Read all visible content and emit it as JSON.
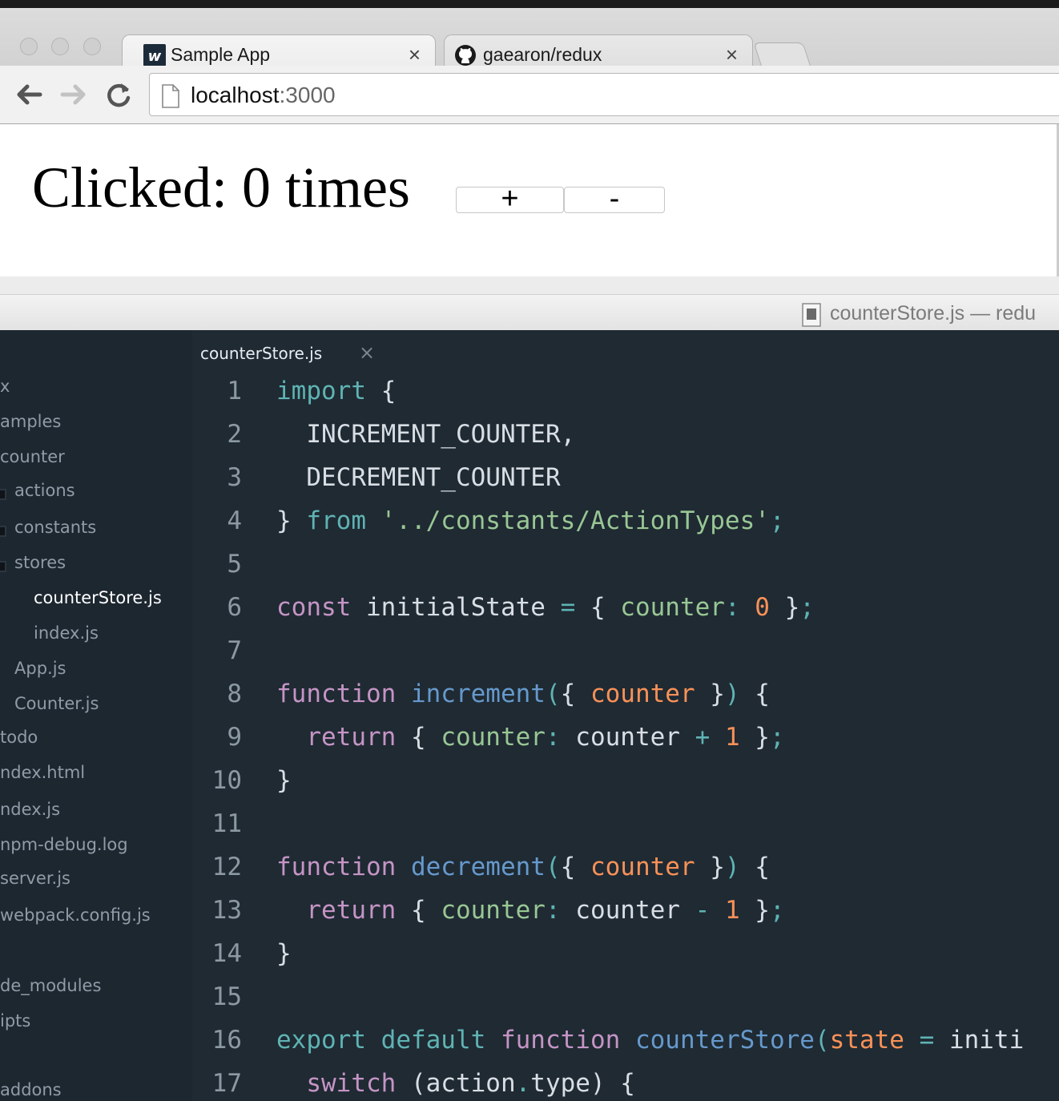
{
  "browser": {
    "tabs": [
      {
        "title": "Sample App",
        "favicon": "w-logo-icon",
        "active": true
      },
      {
        "title": "gaearon/redux",
        "favicon": "github-icon",
        "active": false
      }
    ],
    "close_glyph": "×",
    "address": {
      "host": "localhost",
      "port": ":3000"
    }
  },
  "app": {
    "counter_text": "Clicked: 0 times",
    "increment_label": "+",
    "decrement_label": "-"
  },
  "editor": {
    "window_title": "counterStore.js — redu",
    "open_tab": "counterStore.js",
    "tab_close_glyph": "×",
    "tree": [
      {
        "label": "x",
        "state": "normal"
      },
      {
        "label": "amples",
        "state": "normal"
      },
      {
        "label": "counter",
        "state": "normal"
      },
      {
        "label": "actions",
        "state": "folder"
      },
      {
        "label": "constants",
        "state": "folder"
      },
      {
        "label": "stores",
        "state": "folder"
      },
      {
        "label": "counterStore.js",
        "state": "active"
      },
      {
        "label": "index.js",
        "state": "normal"
      },
      {
        "label": "App.js",
        "state": "normal"
      },
      {
        "label": "Counter.js",
        "state": "normal"
      },
      {
        "label": "todo",
        "state": "normal"
      },
      {
        "label": "ndex.html",
        "state": "normal"
      },
      {
        "label": "ndex.js",
        "state": "normal"
      },
      {
        "label": "npm-debug.log",
        "state": "normal"
      },
      {
        "label": "server.js",
        "state": "normal"
      },
      {
        "label": "webpack.config.js",
        "state": "normal"
      },
      {
        "label": "de_modules",
        "state": "normal"
      },
      {
        "label": "ipts",
        "state": "normal"
      },
      {
        "label": "addons",
        "state": "normal"
      }
    ],
    "line_numbers": [
      "1",
      "2",
      "3",
      "4",
      "5",
      "6",
      "7",
      "8",
      "9",
      "10",
      "11",
      "12",
      "13",
      "14",
      "15",
      "16",
      "17"
    ],
    "code": [
      [
        {
          "t": "import",
          "c": "kw"
        },
        {
          "t": " {",
          "c": "txt"
        }
      ],
      [
        {
          "t": "  INCREMENT_COUNTER,",
          "c": "txt"
        }
      ],
      [
        {
          "t": "  DECREMENT_COUNTER",
          "c": "txt"
        }
      ],
      [
        {
          "t": "} ",
          "c": "txt"
        },
        {
          "t": "from",
          "c": "kw"
        },
        {
          "t": " ",
          "c": "txt"
        },
        {
          "t": "'../constants/ActionTypes'",
          "c": "str"
        },
        {
          "t": ";",
          "c": "op"
        }
      ],
      [],
      [
        {
          "t": "const",
          "c": "kw2"
        },
        {
          "t": " initialState ",
          "c": "txt"
        },
        {
          "t": "=",
          "c": "op"
        },
        {
          "t": " { ",
          "c": "txt"
        },
        {
          "t": "counter",
          "c": "prop"
        },
        {
          "t": ":",
          "c": "op"
        },
        {
          "t": " ",
          "c": "txt"
        },
        {
          "t": "0",
          "c": "num"
        },
        {
          "t": " }",
          "c": "txt"
        },
        {
          "t": ";",
          "c": "op"
        }
      ],
      [],
      [
        {
          "t": "function",
          "c": "kw2"
        },
        {
          "t": " ",
          "c": "txt"
        },
        {
          "t": "increment",
          "c": "fn"
        },
        {
          "t": "(",
          "c": "op"
        },
        {
          "t": "{ ",
          "c": "txt"
        },
        {
          "t": "counter",
          "c": "param"
        },
        {
          "t": " }",
          "c": "txt"
        },
        {
          "t": ")",
          "c": "op"
        },
        {
          "t": " {",
          "c": "txt"
        }
      ],
      [
        {
          "t": "  ",
          "c": "txt"
        },
        {
          "t": "return",
          "c": "kw2"
        },
        {
          "t": " { ",
          "c": "txt"
        },
        {
          "t": "counter",
          "c": "prop"
        },
        {
          "t": ":",
          "c": "op"
        },
        {
          "t": " counter ",
          "c": "txt"
        },
        {
          "t": "+",
          "c": "op"
        },
        {
          "t": " ",
          "c": "txt"
        },
        {
          "t": "1",
          "c": "num"
        },
        {
          "t": " }",
          "c": "txt"
        },
        {
          "t": ";",
          "c": "op"
        }
      ],
      [
        {
          "t": "}",
          "c": "txt"
        }
      ],
      [],
      [
        {
          "t": "function",
          "c": "kw2"
        },
        {
          "t": " ",
          "c": "txt"
        },
        {
          "t": "decrement",
          "c": "fn"
        },
        {
          "t": "(",
          "c": "op"
        },
        {
          "t": "{ ",
          "c": "txt"
        },
        {
          "t": "counter",
          "c": "param"
        },
        {
          "t": " }",
          "c": "txt"
        },
        {
          "t": ")",
          "c": "op"
        },
        {
          "t": " {",
          "c": "txt"
        }
      ],
      [
        {
          "t": "  ",
          "c": "txt"
        },
        {
          "t": "return",
          "c": "kw2"
        },
        {
          "t": " { ",
          "c": "txt"
        },
        {
          "t": "counter",
          "c": "prop"
        },
        {
          "t": ":",
          "c": "op"
        },
        {
          "t": " counter ",
          "c": "txt"
        },
        {
          "t": "-",
          "c": "op"
        },
        {
          "t": " ",
          "c": "txt"
        },
        {
          "t": "1",
          "c": "num"
        },
        {
          "t": " }",
          "c": "txt"
        },
        {
          "t": ";",
          "c": "op"
        }
      ],
      [
        {
          "t": "}",
          "c": "txt"
        }
      ],
      [],
      [
        {
          "t": "export",
          "c": "kw"
        },
        {
          "t": " ",
          "c": "txt"
        },
        {
          "t": "default",
          "c": "kw"
        },
        {
          "t": " ",
          "c": "txt"
        },
        {
          "t": "function",
          "c": "kw2"
        },
        {
          "t": " ",
          "c": "txt"
        },
        {
          "t": "counterStore",
          "c": "fn"
        },
        {
          "t": "(",
          "c": "op"
        },
        {
          "t": "state",
          "c": "param"
        },
        {
          "t": " ",
          "c": "txt"
        },
        {
          "t": "=",
          "c": "op"
        },
        {
          "t": " initi",
          "c": "txt"
        }
      ],
      [
        {
          "t": "  ",
          "c": "txt"
        },
        {
          "t": "switch",
          "c": "kw2"
        },
        {
          "t": " (action",
          "c": "txt"
        },
        {
          "t": ".",
          "c": "op"
        },
        {
          "t": "type) {",
          "c": "txt"
        }
      ]
    ]
  }
}
